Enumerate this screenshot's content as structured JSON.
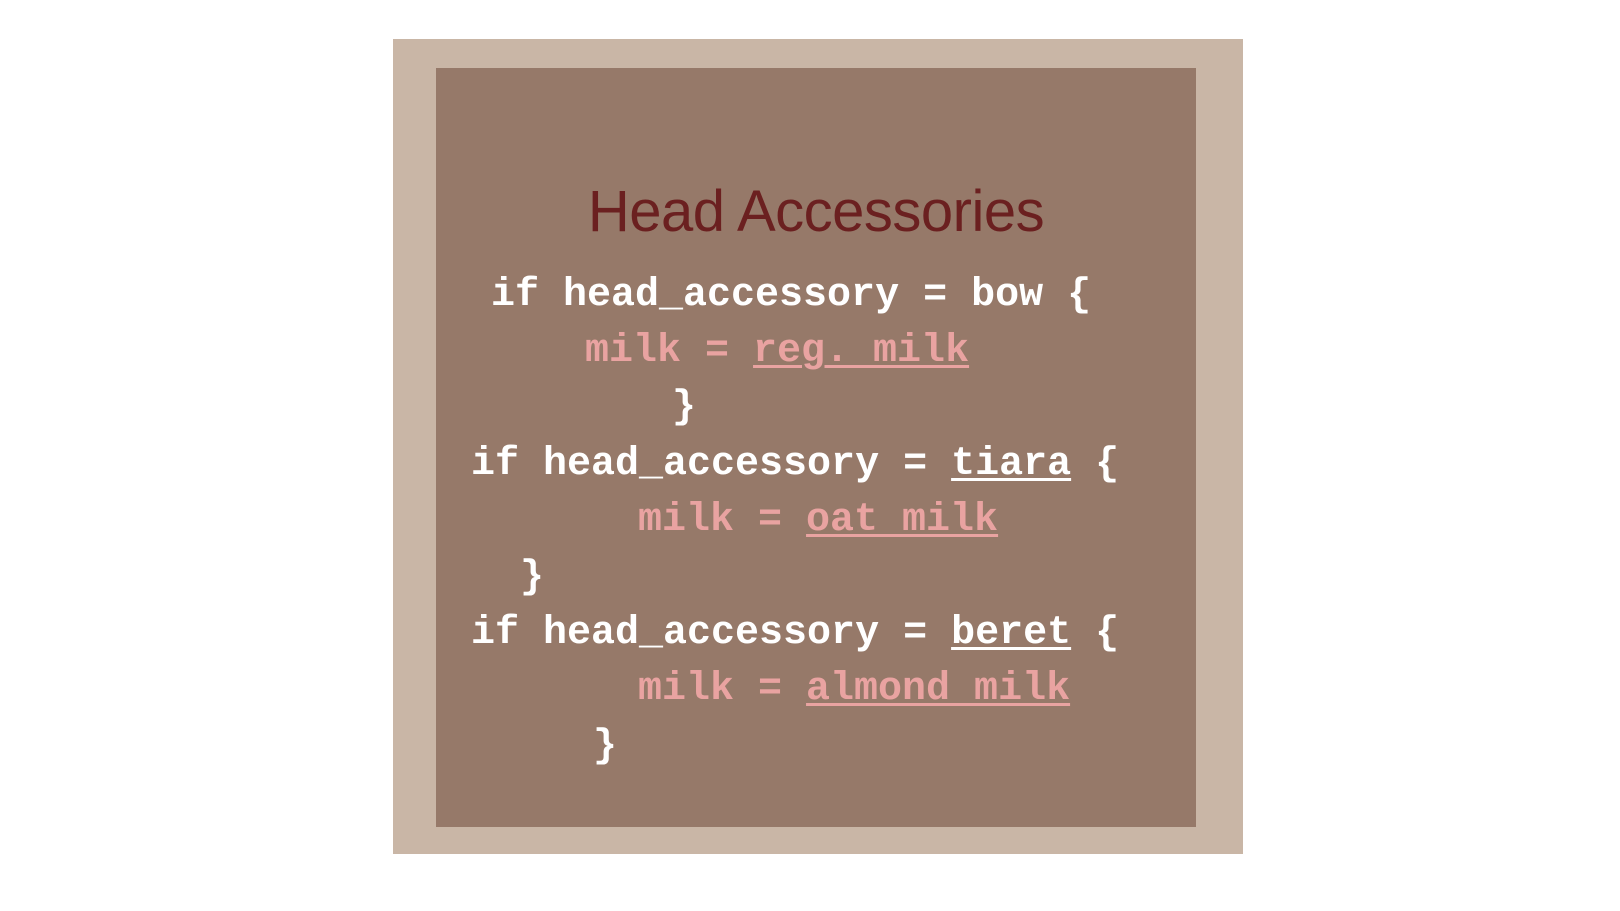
{
  "slide": {
    "title": "Head Accessories",
    "colors": {
      "background": "#ffffff",
      "frame_outer": "#c9b6a6",
      "frame_inner": "#967969",
      "title": "#6b2020",
      "code_text": "#ffffff",
      "milk_text": "#e9a3a1"
    },
    "blocks": [
      {
        "if_prefix": "if head_accessory = ",
        "accessory": "bow",
        "open": " {",
        "milk_prefix": "milk = ",
        "milk_value": "reg. milk",
        "close": "}"
      },
      {
        "if_prefix": "if head_accessory = ",
        "accessory": "tiara",
        "open": " {",
        "milk_prefix": "milk = ",
        "milk_value": "oat milk",
        "close": "}"
      },
      {
        "if_prefix": "if head_accessory = ",
        "accessory": "beret",
        "open": " {",
        "milk_prefix": "milk = ",
        "milk_value": "almond milk",
        "close": "}"
      }
    ]
  }
}
